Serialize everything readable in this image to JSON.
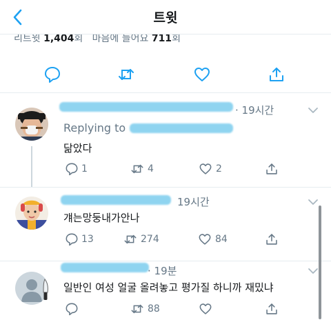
{
  "header": {
    "title": "트윗"
  },
  "stats": {
    "retweets_label": "리트윗",
    "retweets_count": "1,404",
    "retweets_unit": "회",
    "likes_label": "마음에 들어요",
    "likes_count": "711",
    "likes_unit": "회"
  },
  "replies": [
    {
      "time": "· 19시간",
      "replying_to": "Replying to",
      "text": "닮았다",
      "reply_count": "1",
      "retweet_count": "4",
      "like_count": "2"
    },
    {
      "time": "19시간",
      "text": "걔는망둥내가안나",
      "reply_count": "13",
      "retweet_count": "274",
      "like_count": "84"
    },
    {
      "time": "· 19분",
      "text": "일반인 여성 얼굴 올려놓고 평가질 하니까 재밌냐",
      "reply_count": "",
      "retweet_count": "88",
      "like_count": ""
    }
  ],
  "icons": {
    "reply": "speech-bubble-icon",
    "retweet": "retweet-icon",
    "like": "heart-icon",
    "share": "share-icon",
    "back": "chevron-left-icon",
    "more": "chevron-down-icon"
  },
  "colors": {
    "accent": "#1da1f2",
    "muted": "#657786",
    "border": "#e6ecf0",
    "redaction": "#8fd4f0"
  }
}
